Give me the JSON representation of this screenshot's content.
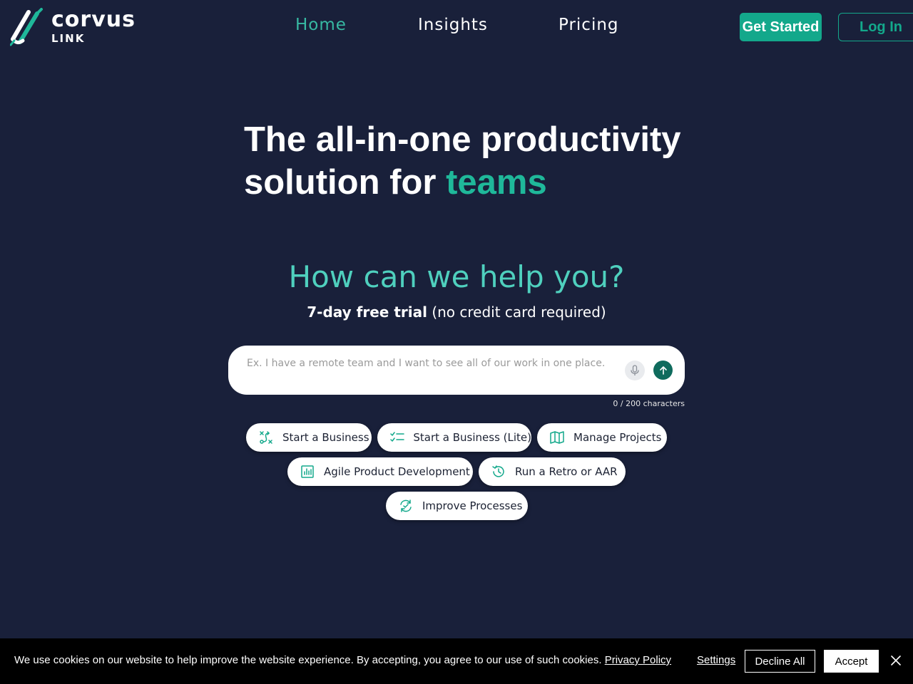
{
  "brand": {
    "name": "corvus",
    "sub": "LINK"
  },
  "nav": {
    "home": "Home",
    "insights": "Insights",
    "pricing": "Pricing",
    "get_started": "Get Started",
    "log_in": "Log In"
  },
  "hero": {
    "title_line1": "The all-in-one productivity",
    "title_line2_prefix": "solution for ",
    "title_accent": "teams"
  },
  "help": {
    "title": "How can we help you?",
    "trial_bold": "7-day free trial",
    "trial_rest": " (no credit card required)"
  },
  "prompt": {
    "placeholder": "Ex. I have a remote team and I want to see all of our work in one place.",
    "value": "",
    "char_count": "0 / 200 characters",
    "mic_icon": "microphone-icon",
    "send_icon": "arrow-up-icon"
  },
  "chips": [
    {
      "label": "Start a Business",
      "icon": "route-icon"
    },
    {
      "label": "Start a Business (Lite)",
      "icon": "checklist-icon"
    },
    {
      "label": "Manage Projects",
      "icon": "map-icon"
    },
    {
      "label": "Agile Product Development",
      "icon": "bar-chart-icon"
    },
    {
      "label": "Run a Retro or AAR",
      "icon": "history-icon"
    },
    {
      "label": "Improve Processes",
      "icon": "refresh-check-icon"
    }
  ],
  "cookie": {
    "text": "We use cookies on our website to help improve the website experience. By accepting, you agree to our use of such cookies. ",
    "privacy_link": "Privacy Policy",
    "settings": "Settings",
    "decline": "Decline All",
    "accept": "Accept"
  },
  "colors": {
    "background": "#19203a",
    "accent": "#13a88b",
    "accent_light": "#4fd0be",
    "send_button": "#0f6b5d"
  }
}
